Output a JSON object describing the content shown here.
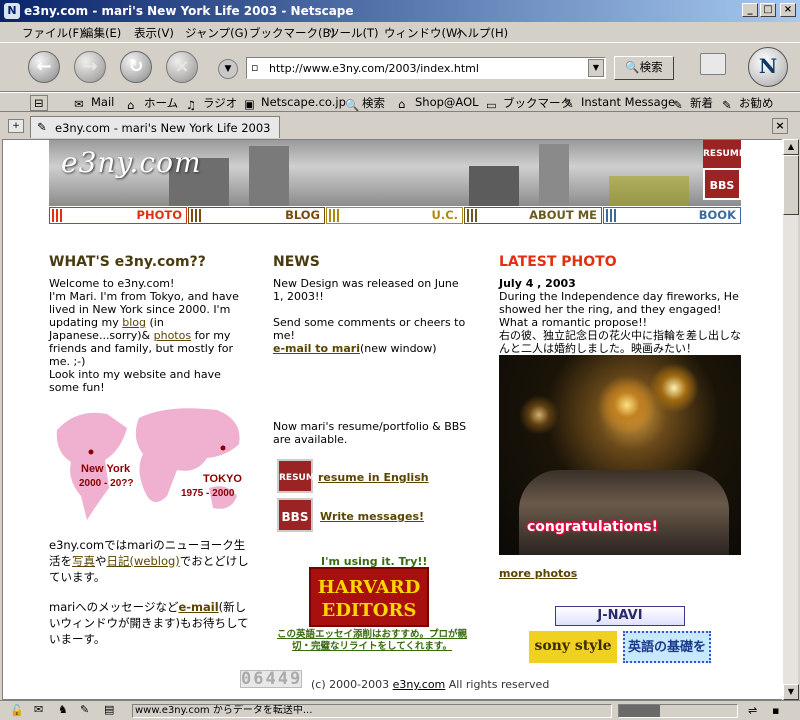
{
  "window": {
    "title": "e3ny.com - mari's New York Life 2003 - Netscape"
  },
  "menu": [
    "ファイル(F)",
    "編集(E)",
    "表示(V)",
    "ジャンプ(G)",
    "ブックマーク(B)",
    "ツール(T)",
    "ウィンドウ(W)",
    "ヘルプ(H)"
  ],
  "navbar": {
    "url": "http://www.e3ny.com/2003/index.html",
    "search_label": "検索"
  },
  "personal_toolbar": [
    "Mail",
    "ホーム",
    "ラジオ",
    "Netscape.co.jp",
    "検索",
    "Shop@AOL",
    "ブックマーク",
    "Instant Message",
    "新着",
    "お勧め"
  ],
  "tab": {
    "label": "e3ny.com - mari's New York Life 2003"
  },
  "page": {
    "logo": "e3ny.com",
    "banner_resume": "RESUME",
    "banner_bbs": "BBS",
    "nav": [
      {
        "label": "PHOTO",
        "color": "#e03010"
      },
      {
        "label": "BLOG",
        "color": "#7a4a10"
      },
      {
        "label": "U.C.",
        "color": "#b08a10"
      },
      {
        "label": "ABOUT ME",
        "color": "#6a5a20"
      },
      {
        "label": "BOOK",
        "color": "#3a6aa0"
      }
    ],
    "whats": {
      "heading": "WHAT'S e3ny.com??",
      "line1": "Welcome to e3ny.com!",
      "line2_pre": "I'm Mari. I'm from Tokyo, and have lived in New York since 2000. I'm updating my ",
      "blog_link": "blog",
      "line2_mid": " (in Japanese...sorry)& ",
      "photos_link": "photos",
      "line2_post": " for my friends and family, but mostly for me. ;-)",
      "line3": "Look into my website and have some fun!",
      "map_ny": "New York",
      "map_ny_years": "2000 - 20??",
      "map_tokyo": "TOKYO",
      "map_tokyo_years": "1975 - 2000",
      "jp1_pre": "e3ny.comではmariのニューヨーク生活を",
      "jp1_photo": "写真",
      "jp1_mid": "や",
      "jp1_diary": "日記(weblog)",
      "jp1_post": "でおとどけしています。",
      "jp2_pre": "mariへのメッセージなど",
      "jp2_email": "e-mail",
      "jp2_post": "(新しいウィンドウが開きます)もお待ちしていまーす。"
    },
    "news": {
      "heading": "NEWS",
      "item1": "New Design was released on June 1, 2003!!",
      "item2": "Send some comments or cheers to me!",
      "email_link": "e-mail to mari",
      "email_note": "(new window)",
      "item3": "Now mari's resume/portfolio & BBS are available.",
      "resume_icon": "RESUME",
      "resume_link": "resume in English",
      "bbs_icon": "BBS",
      "bbs_link": "Write messages!",
      "try_label": "I'm using it. Try!!",
      "harvard_line1": "HARVARD",
      "harvard_line2": "EDITORS",
      "harvard_caption": "この英語エッセイ添削はおすすめ。プロが親切・完璧なリライトをしてくれます。"
    },
    "latest": {
      "heading": "LATEST PHOTO",
      "date": "July 4 , 2003",
      "caption_en": "During the Independence day fireworks, He showed her the ring, and they engaged! What a romantic propose!!",
      "caption_jp": "右の彼、独立記念日の花火中に指輪を差し出しなんと二人は婚約しました。映画みたい！",
      "overlay": "congratulations!",
      "more_link": "more photos",
      "jnavi": "J-NAVI",
      "sony": "sony style",
      "eigo": "英語の基礎を"
    },
    "counter": "06449",
    "copyright_pre": "(c) 2000-2003 ",
    "copyright_link": "e3ny.com",
    "copyright_post": " All rights reserved"
  },
  "status": {
    "text": "www.e3ny.com からデータを転送中...",
    "progress": 0.35
  }
}
